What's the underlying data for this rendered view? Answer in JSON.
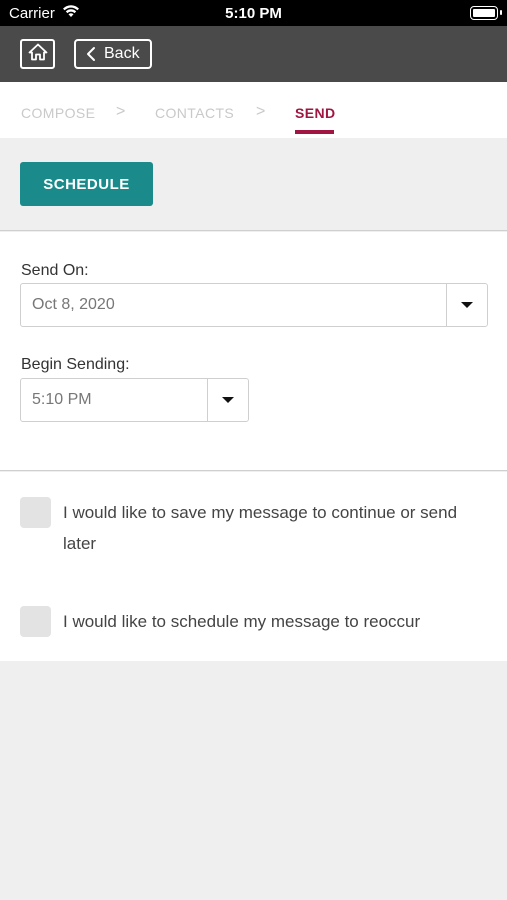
{
  "status_bar": {
    "carrier": "Carrier",
    "time": "5:10 PM"
  },
  "top_bar": {
    "back_label": "Back"
  },
  "steps": {
    "compose": "COMPOSE",
    "separator": ">",
    "contacts": "CONTACTS",
    "send": "SEND",
    "active_color": "#a01541"
  },
  "schedule_button": {
    "label": "SCHEDULE",
    "color": "#1a8a8a"
  },
  "send_on": {
    "label": "Send On:",
    "value": "Oct 8, 2020"
  },
  "begin_sending": {
    "label": "Begin Sending:",
    "value": "5:10 PM"
  },
  "options": {
    "save_later": "I would like to save my message to continue or send later",
    "reoccur": "I would like to schedule my message to reoccur"
  }
}
